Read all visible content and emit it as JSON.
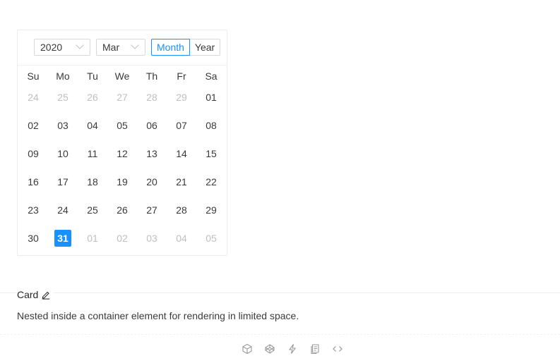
{
  "calendar": {
    "year": "2020",
    "month": "Mar",
    "modes": {
      "month": "Month",
      "year": "Year"
    },
    "weekdays": [
      "Su",
      "Mo",
      "Tu",
      "We",
      "Th",
      "Fr",
      "Sa"
    ],
    "weeks": [
      [
        {
          "d": "24",
          "o": true
        },
        {
          "d": "25",
          "o": true
        },
        {
          "d": "26",
          "o": true
        },
        {
          "d": "27",
          "o": true
        },
        {
          "d": "28",
          "o": true
        },
        {
          "d": "29",
          "o": true
        },
        {
          "d": "01"
        }
      ],
      [
        {
          "d": "02"
        },
        {
          "d": "03"
        },
        {
          "d": "04"
        },
        {
          "d": "05"
        },
        {
          "d": "06"
        },
        {
          "d": "07"
        },
        {
          "d": "08"
        }
      ],
      [
        {
          "d": "09"
        },
        {
          "d": "10"
        },
        {
          "d": "11"
        },
        {
          "d": "12"
        },
        {
          "d": "13"
        },
        {
          "d": "14"
        },
        {
          "d": "15"
        }
      ],
      [
        {
          "d": "16"
        },
        {
          "d": "17"
        },
        {
          "d": "18"
        },
        {
          "d": "19"
        },
        {
          "d": "20"
        },
        {
          "d": "21"
        },
        {
          "d": "22"
        }
      ],
      [
        {
          "d": "23"
        },
        {
          "d": "24"
        },
        {
          "d": "25"
        },
        {
          "d": "26"
        },
        {
          "d": "27"
        },
        {
          "d": "28"
        },
        {
          "d": "29"
        }
      ],
      [
        {
          "d": "30"
        },
        {
          "d": "31",
          "selected": true
        },
        {
          "d": "01",
          "o": true
        },
        {
          "d": "02",
          "o": true
        },
        {
          "d": "03",
          "o": true
        },
        {
          "d": "04",
          "o": true
        },
        {
          "d": "05",
          "o": true
        }
      ]
    ]
  },
  "card": {
    "title": "Card",
    "description": "Nested inside a container element for rendering in limited space."
  },
  "icons": [
    "codesandbox-icon",
    "codepen-icon",
    "thunderbolt-icon",
    "copy-icon",
    "code-icon"
  ],
  "colors": {
    "accent": "#1890ff",
    "muted": "#bfbfbf"
  }
}
